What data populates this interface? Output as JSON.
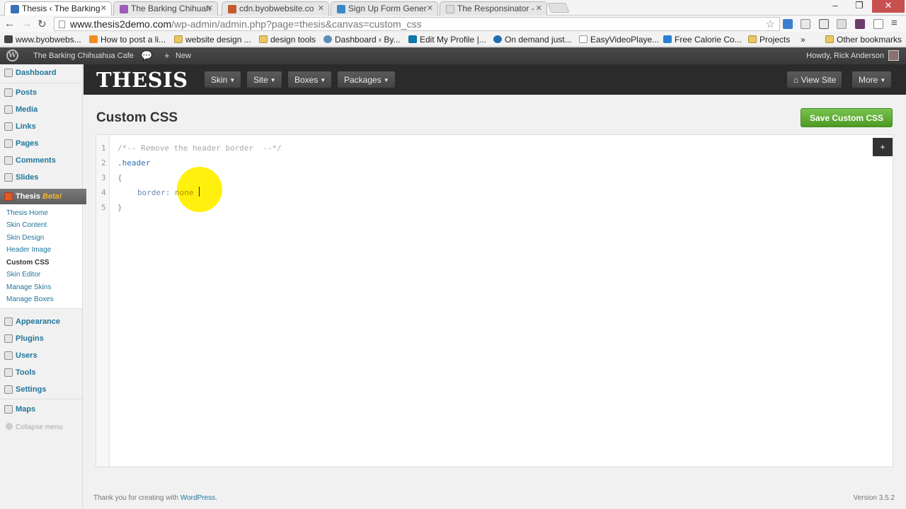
{
  "browser": {
    "tabs": [
      {
        "title": "Thesis ‹ The Barking",
        "active": true
      },
      {
        "title": "The Barking Chihuah",
        "active": false
      },
      {
        "title": "cdn.byobwebsite.co",
        "active": false
      },
      {
        "title": "Sign Up Form Gener",
        "active": false
      },
      {
        "title": "The Responsinator -",
        "active": false
      }
    ],
    "url_host": "www.thesis2demo.com",
    "url_path": "/wp-admin/admin.php?page=thesis&canvas=custom_css",
    "bookmarks": [
      "www.byobwebs...",
      "How to post a li...",
      "website design ...",
      "design tools",
      "Dashboard ‹ By...",
      "Edit My Profile |...",
      "On demand just...",
      "EasyVideoPlaye...",
      "Free Calorie Co...",
      "Projects"
    ],
    "bookmarks_more": "»",
    "other_bookmarks": "Other bookmarks"
  },
  "adminbar": {
    "site_name": "The Barking Chihuahua Cafe",
    "new_label": "New",
    "howdy": "Howdy, Rick Anderson"
  },
  "sidebar": {
    "items_top": [
      "Dashboard",
      "Posts",
      "Media",
      "Links",
      "Pages",
      "Comments",
      "Slides"
    ],
    "thesis_label": "Thesis",
    "thesis_badge": "Beta!",
    "submenu": [
      "Thesis Home",
      "Skin Content",
      "Skin Design",
      "Header Image",
      "Custom CSS",
      "Skin Editor",
      "Manage Skins",
      "Manage Boxes"
    ],
    "submenu_current": "Custom CSS",
    "items_bottom": [
      "Appearance",
      "Plugins",
      "Users",
      "Tools",
      "Settings"
    ],
    "maps": "Maps",
    "collapse": "Collapse menu"
  },
  "thesis": {
    "logo": "THESIS",
    "menu": [
      "Skin",
      "Site",
      "Boxes",
      "Packages"
    ],
    "view_site": "View Site",
    "more": "More"
  },
  "page": {
    "title": "Custom CSS",
    "save_button": "Save Custom CSS",
    "expand_button": "+"
  },
  "editor": {
    "line_numbers": [
      "1",
      "2",
      "3",
      "4",
      "5"
    ],
    "line1": "/*-- Remove the header border  --*/",
    "line2": ".header",
    "line3": "{",
    "line4_prop": "border:",
    "line4_val": "none",
    "line5": "}"
  },
  "footer": {
    "thanks_prefix": "Thank you for creating with ",
    "thanks_link": "WordPress",
    "thanks_suffix": ".",
    "version": "Version 3.5.2"
  },
  "colors": {
    "thesis_bar": "#2b2b2b",
    "save_green": "#5aa832",
    "link_blue": "#21759b",
    "cursor_highlight": "#fff000"
  }
}
